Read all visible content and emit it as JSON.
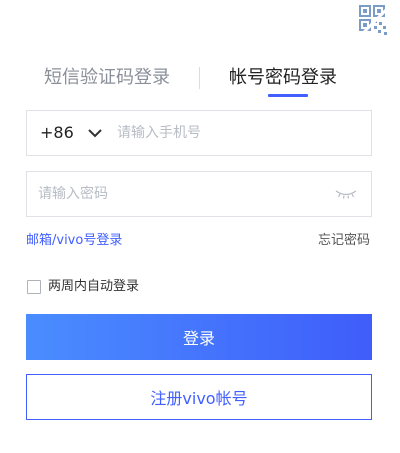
{
  "corner": {
    "icon": "qr-code-icon"
  },
  "tabs": {
    "sms_login": "短信验证码登录",
    "password_login": "帐号密码登录",
    "active": "password_login"
  },
  "phone": {
    "country_code": "+86",
    "placeholder": "请输入手机号",
    "value": ""
  },
  "password": {
    "placeholder": "请输入密码",
    "value": "",
    "toggle_icon": "eye-closed-icon"
  },
  "links": {
    "alt_login": "邮箱/vivo号登录",
    "forgot_password": "忘记密码"
  },
  "remember": {
    "label": "两周内自动登录",
    "checked": false
  },
  "buttons": {
    "login": "登录",
    "register": "注册vivo帐号"
  },
  "colors": {
    "accent": "#415fff",
    "login_gradient_start": "#4a8dff",
    "login_gradient_end": "#3f5dfa",
    "inactive_tab": "#8a8f99"
  }
}
